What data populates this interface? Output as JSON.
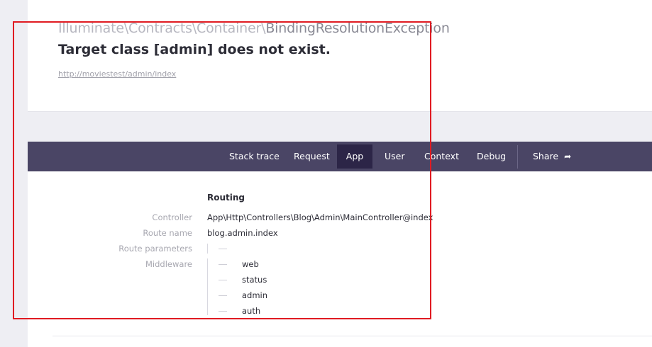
{
  "header": {
    "exception_prefix": "Illuminate\\Contracts\\Container\\",
    "exception_name": "BindingResolutionException",
    "message": "Target class [admin] does not exist.",
    "url": "http://moviestest/admin/index"
  },
  "nav": {
    "tabs": [
      {
        "label": "Stack trace"
      },
      {
        "label": "Request"
      },
      {
        "label": "App",
        "active": true
      },
      {
        "label": "User"
      },
      {
        "label": "Context"
      },
      {
        "label": "Debug"
      }
    ],
    "share_label": "Share",
    "share_icon": "share-arrow-icon"
  },
  "app": {
    "section_title": "Routing",
    "rows": {
      "controller": {
        "label": "Controller",
        "value": "App\\Http\\Controllers\\Blog\\Admin\\MainController@index"
      },
      "route_name": {
        "label": "Route name",
        "value": "blog.admin.index"
      },
      "route_parameters": {
        "label": "Route parameters",
        "value": ""
      },
      "middleware": {
        "label": "Middleware",
        "items": [
          "web",
          "status",
          "admin",
          "auth"
        ]
      }
    }
  },
  "colors": {
    "nav_background": "#4a4565",
    "nav_active": "#2c2547",
    "highlight_border": "#e01b22"
  }
}
